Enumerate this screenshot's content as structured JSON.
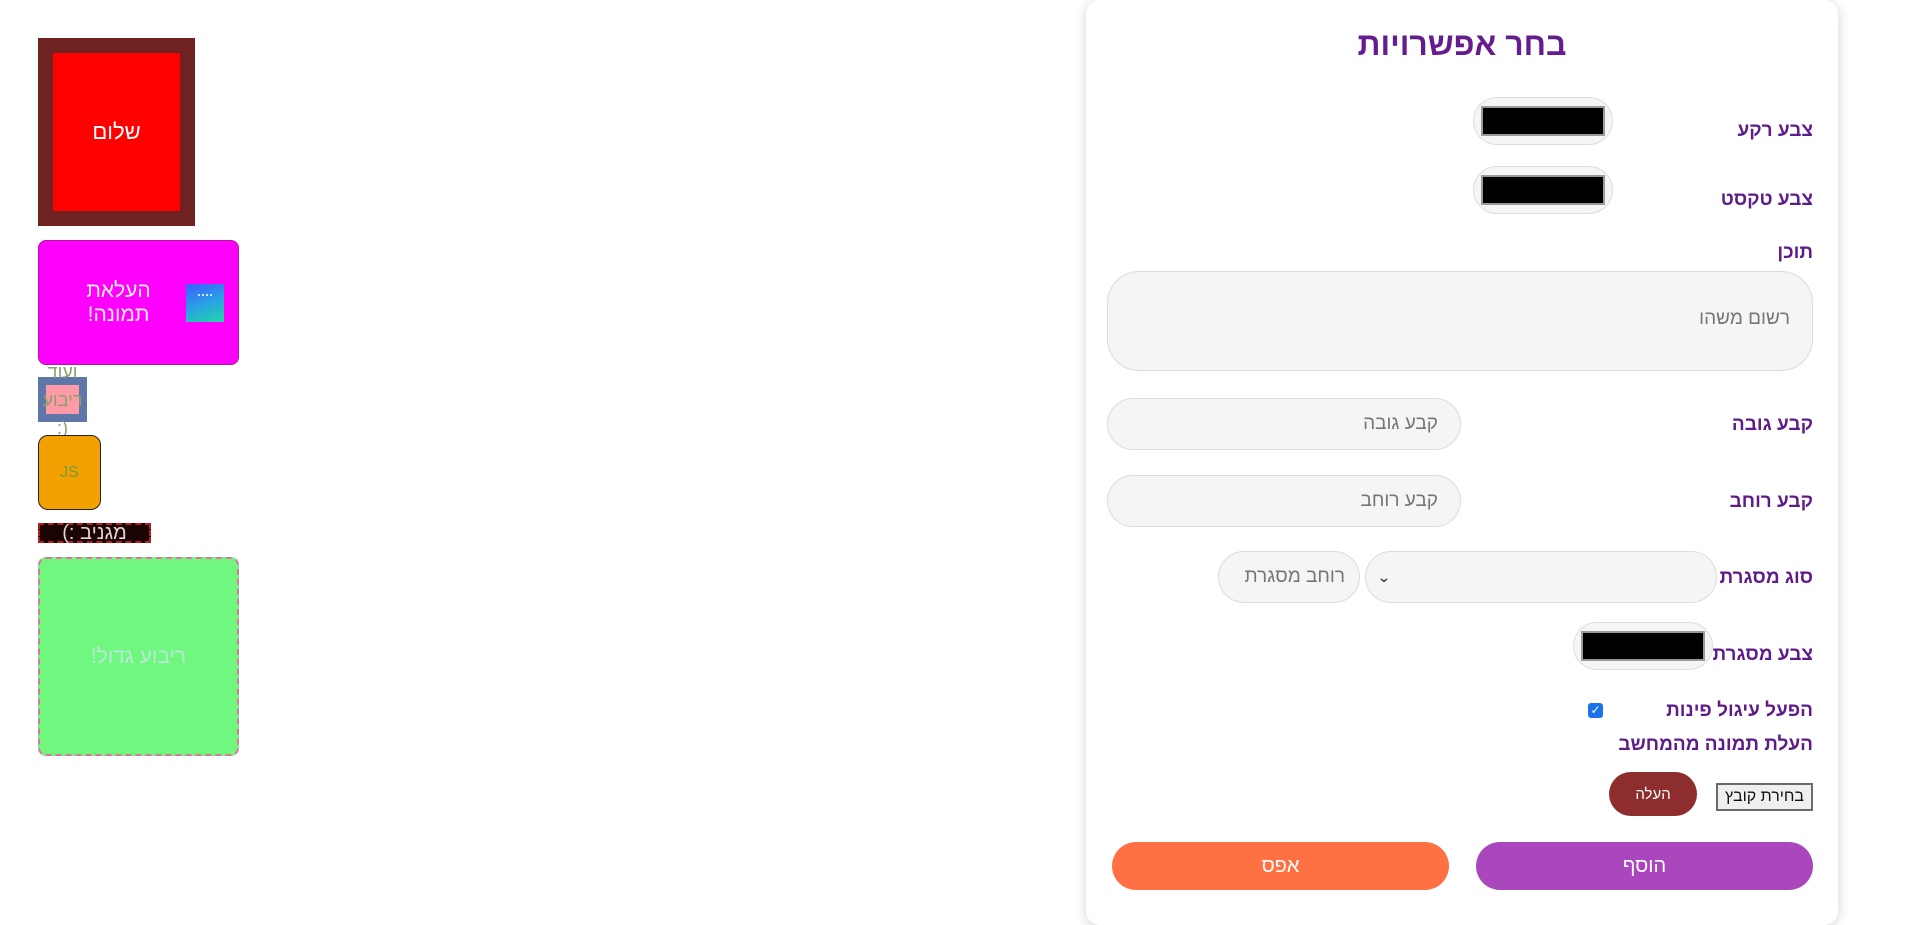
{
  "canvas": {
    "box1_text": "שלום",
    "box2_text": "העלאת תמונה!",
    "box3_lines": [
      "ועוד",
      "ריבוע",
      ":)"
    ],
    "box4_text": "JS",
    "box5_text": "מגניב :)",
    "box6_text": "ריבוע גדול!"
  },
  "form": {
    "title": "בחר אפשרויות",
    "bg_color_label": "צבע רקע",
    "bg_color_value": "#000000",
    "text_color_label": "צבע טקסט",
    "text_color_value": "#000000",
    "content_label": "תוכן",
    "content_placeholder": "רשום משהו",
    "height_label": "קבע גובה",
    "height_placeholder": "קבע גובה",
    "width_label": "קבע רוחב",
    "width_placeholder": "קבע רוחב",
    "border_type_label": "סוג מסגרת",
    "border_type_value": "",
    "border_width_placeholder": "רוחב מסגרת",
    "border_color_label": "צבע מסגרת",
    "border_color_value": "#000000",
    "rounded_label": "הפעל עיגול פינות",
    "rounded_checked": true,
    "upload_label": "העלת תמונה מהמחשב",
    "choose_file_label": "בחירת קובץ",
    "upload_button": "העלה",
    "add_button": "הוסף",
    "reset_button": "אפס"
  },
  "colors": {
    "accent_purple": "#641c8e",
    "add_button": "#ab47bc",
    "reset_button": "#ff7043",
    "upload_button": "#8d2d2d"
  }
}
